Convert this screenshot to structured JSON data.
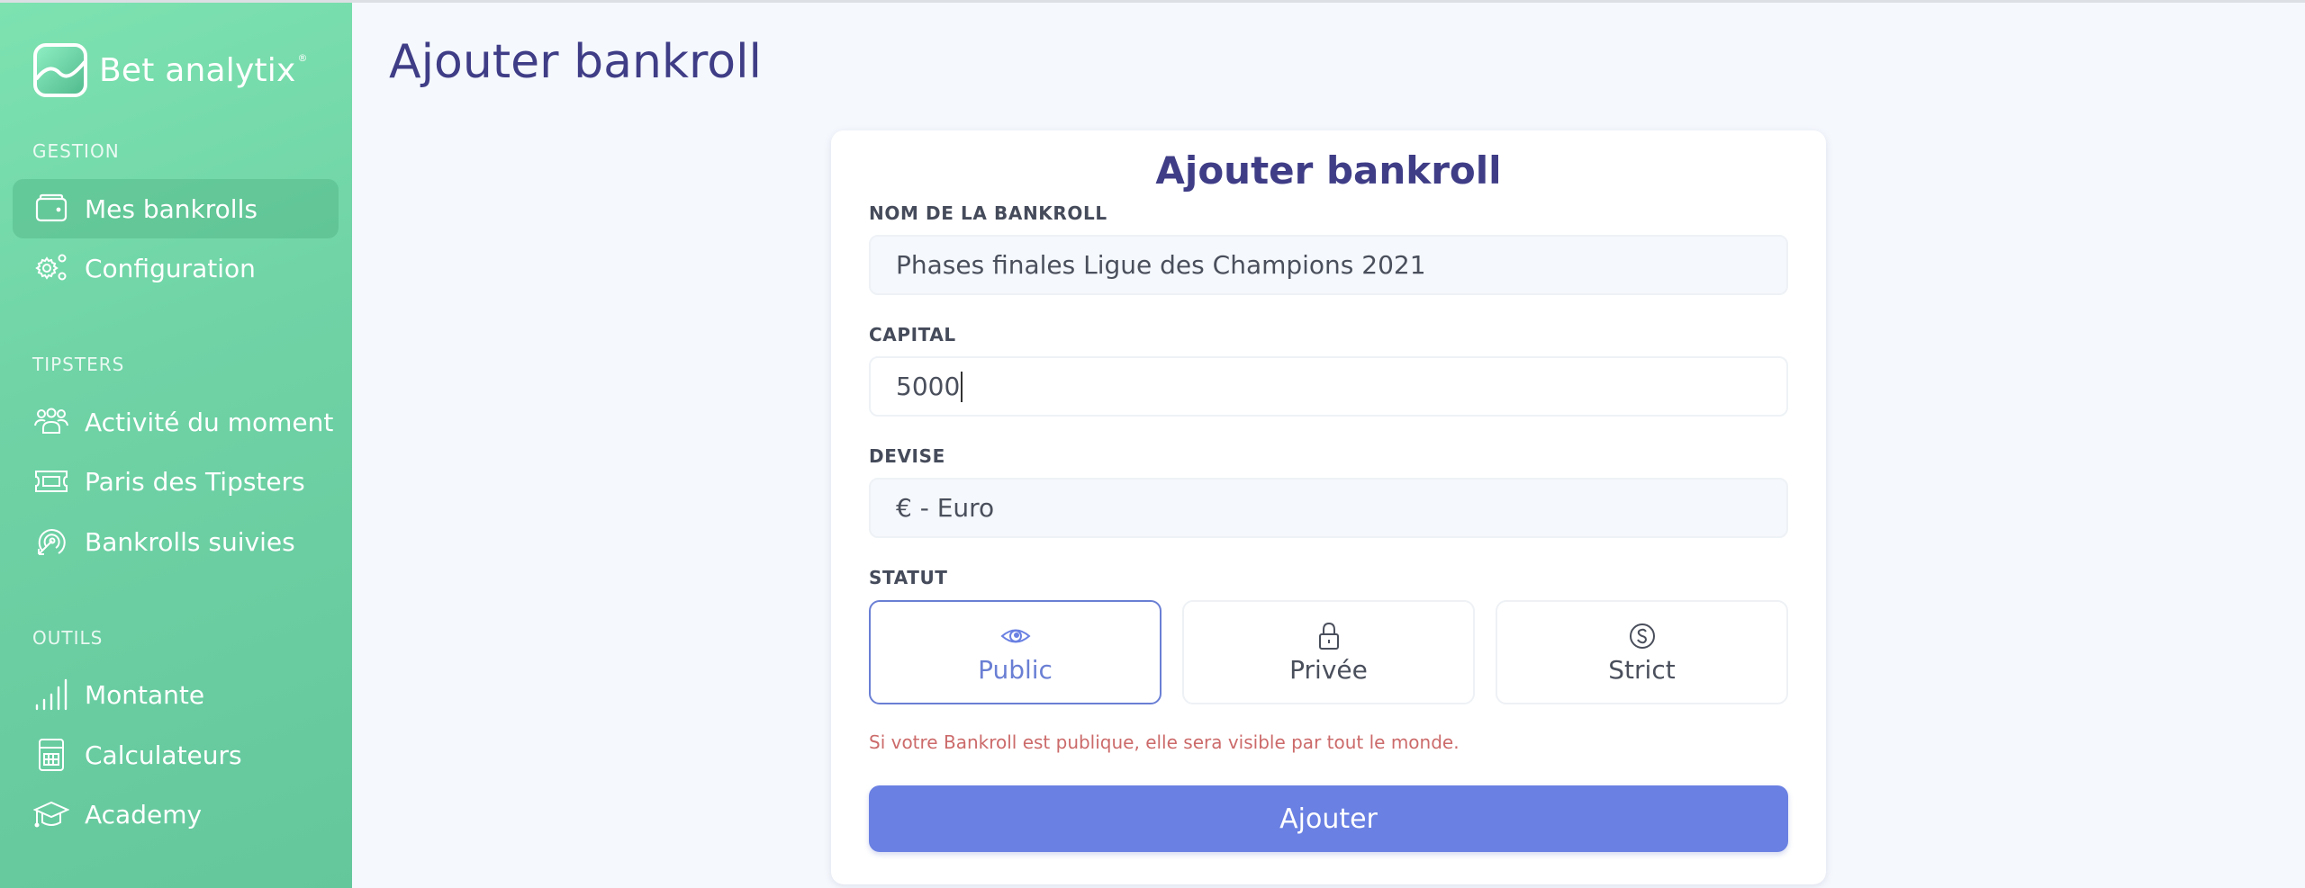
{
  "app": {
    "name": "Bet analytix",
    "registered_mark": "®"
  },
  "sidebar": {
    "sections": [
      {
        "label": "GESTION",
        "items": [
          {
            "label": "Mes bankrolls",
            "icon": "wallet-icon",
            "active": true
          },
          {
            "label": "Configuration",
            "icon": "gears-icon",
            "active": false
          }
        ]
      },
      {
        "label": "TIPSTERS",
        "items": [
          {
            "label": "Activité du moment",
            "icon": "users-icon",
            "active": false
          },
          {
            "label": "Paris des Tipsters",
            "icon": "ticket-icon",
            "active": false
          },
          {
            "label": "Bankrolls suivies",
            "icon": "target-icon",
            "active": false
          }
        ]
      },
      {
        "label": "OUTILS",
        "items": [
          {
            "label": "Montante",
            "icon": "signal-bars-icon",
            "active": false
          },
          {
            "label": "Calculateurs",
            "icon": "calculator-icon",
            "active": false
          },
          {
            "label": "Academy",
            "icon": "graduation-cap-icon",
            "active": false
          }
        ]
      }
    ]
  },
  "page": {
    "title": "Ajouter bankroll"
  },
  "form": {
    "title": "Ajouter bankroll",
    "name_label": "NOM DE LA BANKROLL",
    "name_value": "Phases finales Ligue des Champions 2021",
    "capital_label": "CAPITAL",
    "capital_value": "5000",
    "currency_label": "DEVISE",
    "currency_value": "€ - Euro",
    "status_label": "STATUT",
    "status_options": [
      {
        "label": "Public",
        "icon": "eye-icon",
        "selected": true
      },
      {
        "label": "Privée",
        "icon": "lock-icon",
        "selected": false
      },
      {
        "label": "Strict",
        "icon": "strict-s-icon",
        "selected": false
      }
    ],
    "hint": "Si votre Bankroll est publique, elle sera visible par tout le monde.",
    "submit_label": "Ajouter"
  },
  "colors": {
    "sidebar_green": "#6fd3a6",
    "title_indigo": "#3f3d86",
    "accent_blue": "#6a80e2",
    "hint_red": "#cc6a6a"
  }
}
